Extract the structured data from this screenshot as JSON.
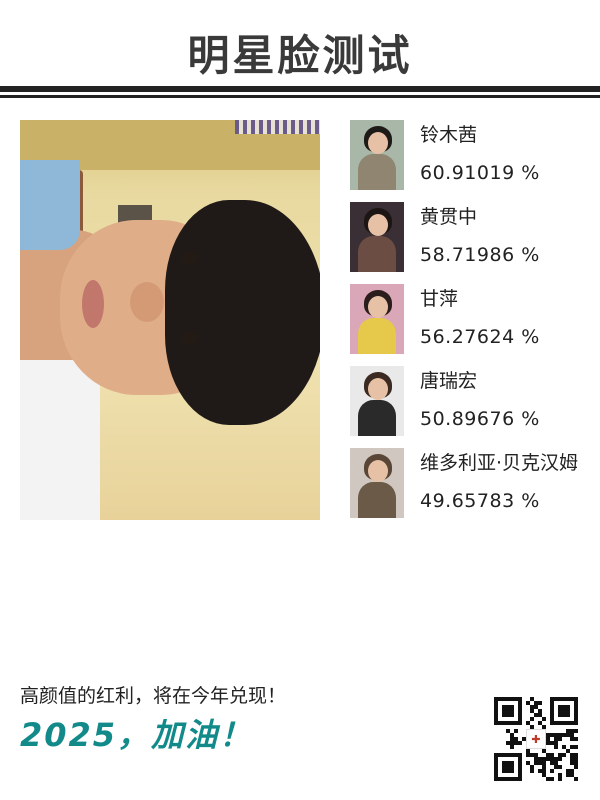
{
  "header": {
    "title": "明星脸测试"
  },
  "photo": {
    "alt": "user selfie"
  },
  "matches": [
    {
      "name": "铃木茜",
      "percent": "60.91019 %",
      "colors": {
        "bg": "#a8b7a8",
        "hair": "#1e1a18",
        "body": "#8f8570"
      }
    },
    {
      "name": "黄贯中",
      "percent": "58.71986 %",
      "colors": {
        "bg": "#3a2f35",
        "hair": "#1b1514",
        "body": "#6b4d43"
      }
    },
    {
      "name": "甘萍",
      "percent": "56.27624 %",
      "colors": {
        "bg": "#d9a7b8",
        "hair": "#2b1d1b",
        "body": "#e6c84a"
      }
    },
    {
      "name": "唐瑞宏",
      "percent": "50.89676 %",
      "colors": {
        "bg": "#e9e9e9",
        "hair": "#3a2a22",
        "body": "#2a2a2a"
      }
    },
    {
      "name": "维多利亚·贝克汉姆",
      "percent": "49.65783 %",
      "colors": {
        "bg": "#cfc7c0",
        "hair": "#5a4636",
        "body": "#6b5a48"
      }
    }
  ],
  "footer": {
    "slogan": "高颜值的红利，将在今年兑现！",
    "cheer": "2025，加油！",
    "qr_label": "QR code"
  },
  "colors": {
    "accent": "#128a8a",
    "rule": "#222222"
  }
}
